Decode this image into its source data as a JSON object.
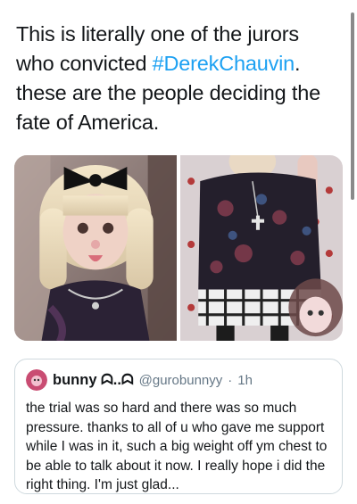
{
  "tweet": {
    "text_before_hashtag": "This is literally one of the jurors who convicted ",
    "hashtag": "#DerekChauvin",
    "text_after_hashtag": ". these are the people deciding the fate of America."
  },
  "media": {
    "images": [
      {
        "description_icon": "selfie-photo-icon"
      },
      {
        "description_icon": "mirror-selfie-photo-icon"
      }
    ]
  },
  "quoted_tweet": {
    "display_name": "bunny ᗣ..ᗣ",
    "handle": "@gurobunnyy",
    "separator": "·",
    "time": "1h",
    "body": "the trial was so hard and there was so much pressure. thanks to all of u who gave me support while I was in it, such a big weight off ym chest to be able to talk about it now. I really hope i did the right thing. I'm just glad..."
  },
  "colors": {
    "hashtag": "#1da1f2",
    "text": "#14171a",
    "muted": "#657786",
    "border": "#cfd9de"
  }
}
